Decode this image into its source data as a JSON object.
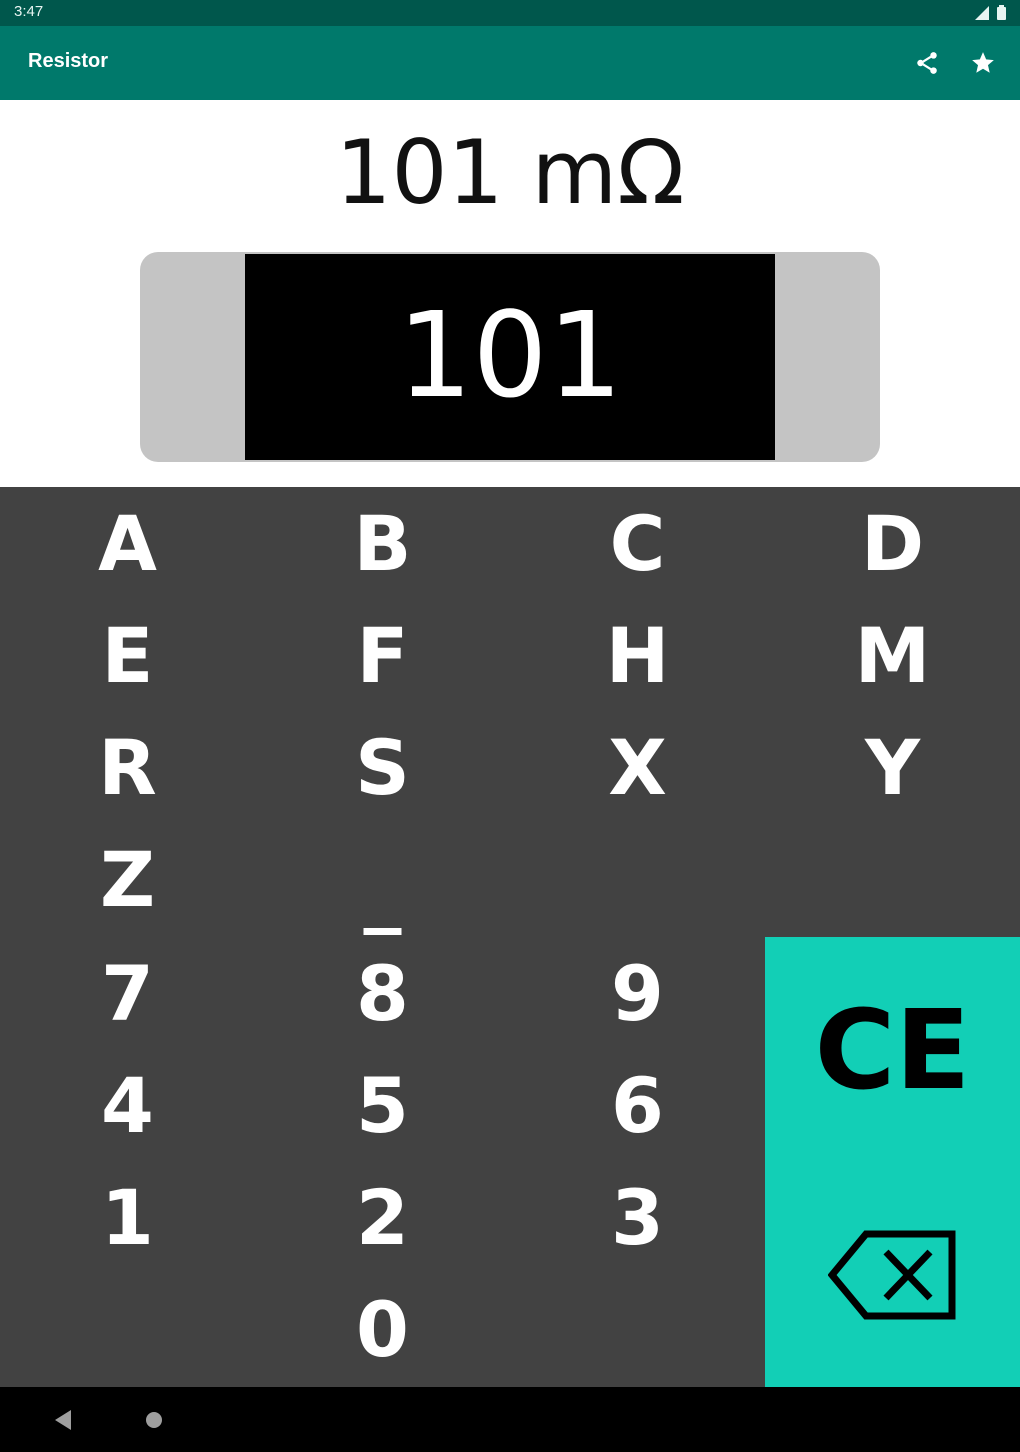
{
  "status_bar": {
    "time": "3:47"
  },
  "app_bar": {
    "title": "Resistor"
  },
  "display": {
    "value": "101 mΩ",
    "code": "101"
  },
  "keypad": {
    "letters": [
      "A",
      "B",
      "C",
      "D",
      "E",
      "F",
      "H",
      "M",
      "R",
      "S",
      "X",
      "Y",
      "Z",
      "_"
    ],
    "digits": [
      "7",
      "8",
      "9",
      "4",
      "5",
      "6",
      "1",
      "2",
      "3",
      "0"
    ],
    "clear_label": "CE"
  },
  "colors": {
    "status_bar": "#00574c",
    "app_bar": "#00796b",
    "keypad_bg": "#424242",
    "accent": "#12cfb6",
    "resistor_end": "#c4c4c4",
    "resistor_body": "#000000"
  },
  "icons": {
    "share": "share-icon",
    "favorite": "star-icon",
    "backspace": "backspace-icon",
    "nav_back": "back-triangle-icon",
    "nav_home": "home-circle-icon"
  }
}
